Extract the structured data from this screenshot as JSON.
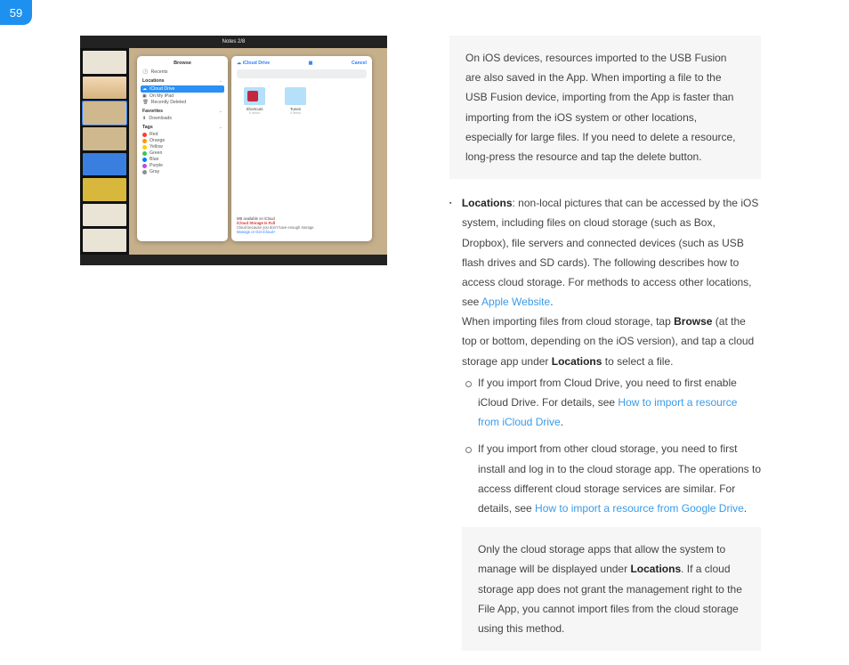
{
  "page_number": "59",
  "ipad": {
    "topbar_title": "Notes 2/8",
    "browse": {
      "title": "Browse",
      "recents": "Recents",
      "locations_label": "Locations",
      "icloud": "iCloud Drive",
      "onipad": "On My iPad",
      "recentlydeleted": "Recently Deleted",
      "favorites_label": "Favorites",
      "downloads": "Downloads",
      "tags_label": "Tags",
      "tags": {
        "red": {
          "label": "Red",
          "color": "#ff3b30"
        },
        "orange": {
          "label": "Orange",
          "color": "#ff9500"
        },
        "yellow": {
          "label": "Yellow",
          "color": "#ffcc00"
        },
        "green": {
          "label": "Green",
          "color": "#34c759"
        },
        "blue": {
          "label": "Blue",
          "color": "#007aff"
        },
        "purple": {
          "label": "Purple",
          "color": "#af52de"
        },
        "gray": {
          "label": "Gray",
          "color": "#8e8e93"
        }
      }
    },
    "drive": {
      "title": "iCloud Drive",
      "cancel": "Cancel",
      "folder_shortcuts": "Shortcuts",
      "folder_shortcuts_under": "5 items",
      "folder_tunes": "Tunes",
      "folder_tunes_under": "4 items",
      "mb_line": "MB available on iCloud",
      "warn_head": "iCloud Storage Is Full",
      "warn_text": "Cloud because you don't have enough storage.",
      "warn_link": "Manage or Get iCloud+"
    }
  },
  "notebox1": "On iOS devices, resources imported to the USB Fusion are also saved in the App. When importing a file to the USB Fusion device, importing from the App is faster than importing from the iOS system or other locations, especially for large files. If you need to delete a resource, long-press the resource and tap the delete button.",
  "bullet_locations_label": "Locations",
  "bullet_locations_text1": ": non-local pictures that can be accessed by the iOS system, including files on cloud storage (such as Box, Dropbox), file servers and connected devices (such as USB flash drives and SD cards). The following describes how to access cloud storage. For methods to access other locations, see ",
  "bullet_locations_link1": "Apple Website",
  "bullet_locations_text2": "When importing files from cloud storage, tap ",
  "bullet_locations_bold_browse": "Browse",
  "bullet_locations_text3": " (at the top or bottom, depending on the iOS version), and tap a cloud storage app under ",
  "bullet_locations_bold_locations": "Locations",
  "bullet_locations_text4": " to select a file.",
  "sub1_text1": "If you import from Cloud Drive, you need to first enable iCloud Drive. For details, see ",
  "sub1_link": "How to import a resource from iCloud Drive",
  "sub2_text1": "If you import from other cloud storage, you need to first install and log in to the cloud storage app. The operations to access different cloud storage services are similar. For details, see ",
  "sub2_link": "How to import a resource from Google Drive",
  "notebox2_text1": "Only the cloud storage apps that allow the system to manage will be displayed under ",
  "notebox2_bold": "Locations",
  "notebox2_text2": ". If a cloud storage app does not grant the management right to the File App, you cannot import files from the cloud storage using this method."
}
